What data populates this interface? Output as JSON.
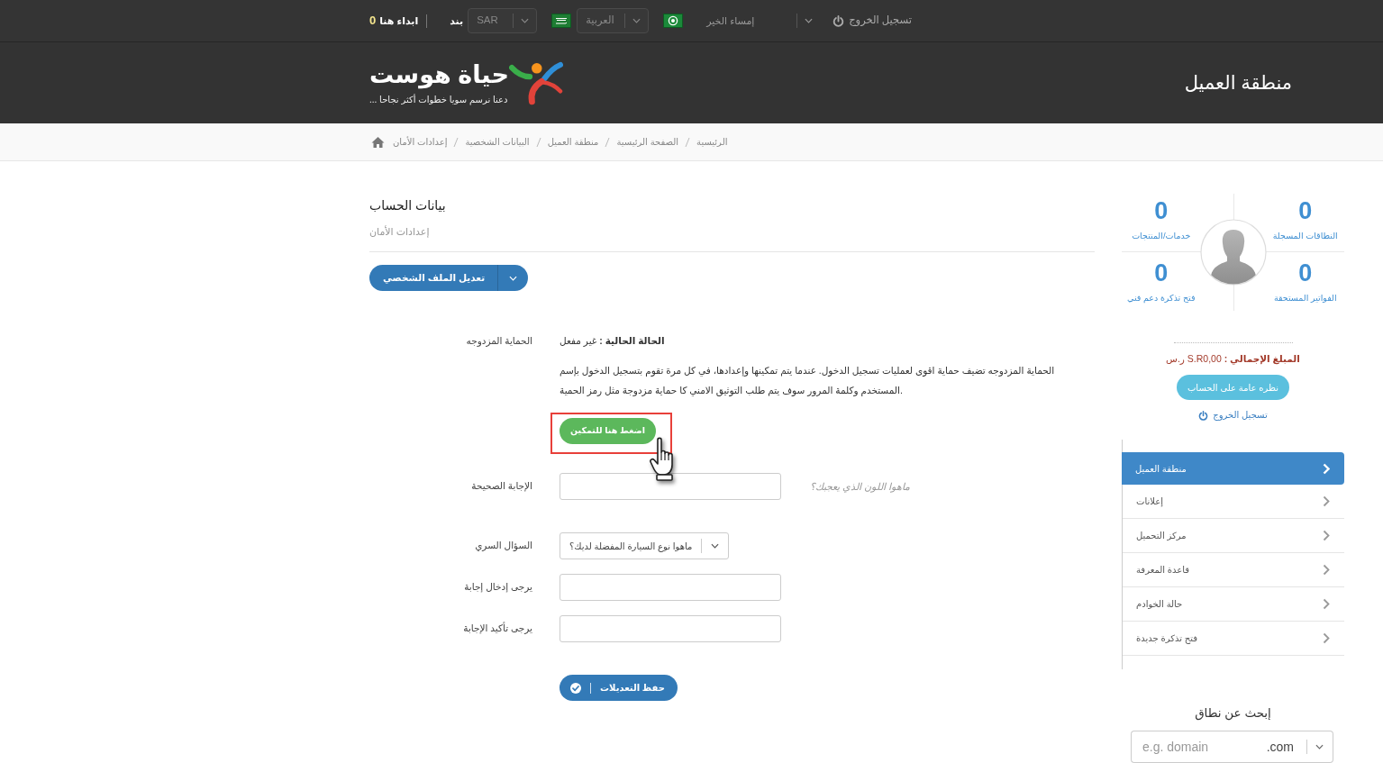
{
  "top_bar": {
    "logout": "تسجيل الخروج",
    "greeting": "إمساء الخير",
    "language": "العربية",
    "currency": "SAR",
    "items_link": "بند",
    "start_link": "ابداء هنا",
    "count": "0"
  },
  "header": {
    "logo_text": "حياة هوست",
    "tagline": "دعنا نرسم سويا خطوات أكثر نجاحا ...",
    "title": "منطقة العميل"
  },
  "breadcrumb": [
    "الرئيسية",
    "الصفحة الرئيسية",
    "منطقة العميل",
    "البيانات الشخصية",
    "إعدادات الأمان"
  ],
  "account": {
    "title": "بيانات الحساب",
    "subtitle": "إعدادات الأمان",
    "profile_button": "تعديل الملف الشخصي"
  },
  "two_factor": {
    "label": "الحماية المزدوجه",
    "status": "**الحالة الحالية :** غير مفعل",
    "description": "الحماية المزدوجه تضيف حماية اقوى لعمليات تسجيل الدخول. عندما يتم تمكينها وإعدادها، في كل مرة تقوم بتسجيل الدخول بإسم المستخدم وكلمة المرور سوف يتم طلب التوثيق الامني كا حماية مزدوجة مثل رمز الحمية.",
    "enable_button": "اضغط هنا للتمكين",
    "highlighted": true,
    "pointer_over": true
  },
  "security_question": {
    "fields": [
      {
        "kind": "input",
        "label": "الإجابة الصحيحة",
        "hint": "ماهوا اللون الذي يعجبك؟"
      },
      {
        "kind": "select",
        "label": "السؤال السري",
        "value": "ماهوا نوع السيارة المفضلة لديك؟"
      },
      {
        "kind": "input",
        "label": "يرجى إدخال إجابة"
      },
      {
        "kind": "input",
        "label": "يرجى تأكيد الإجابة"
      }
    ],
    "save_button": "حفظ التعديلات"
  },
  "sidebar": {
    "stats": [
      {
        "value": "0",
        "label": "النطاقات المسجلة"
      },
      {
        "value": "0",
        "label": "خدمات/المنتجات"
      },
      {
        "value": "0",
        "label": "الفواتير المستحقة"
      },
      {
        "value": "0",
        "label": "فتح تذكرة دعم فني"
      }
    ],
    "total": "**المبلغ الإجمالي :** S.R0,00 ر.س",
    "overview_button": "نظره عامة على الحساب",
    "logout": "تسجيل الخروج",
    "menu": [
      {
        "label": "منطقة العميل",
        "selected": true
      },
      {
        "label": "إعلانات",
        "selected": false
      },
      {
        "label": "مركز التحميل",
        "selected": false
      },
      {
        "label": "قاعدة المعرفة",
        "selected": false
      },
      {
        "label": "حالة الخوادم",
        "selected": false
      },
      {
        "label": "فتح تذكرة جديدة",
        "selected": false
      }
    ],
    "domain_search": {
      "title": "إبحث عن نطاق",
      "placeholder": "e.g. domain",
      "tld": ".com"
    }
  }
}
